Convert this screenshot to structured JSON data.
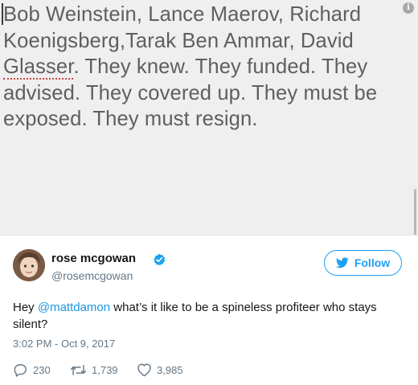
{
  "note": {
    "line1_pre": "Bob Weinstein, Lance Maerov, Richard",
    "line2": "Koenigsberg,Tarak Ben Ammar, David",
    "line3_misspelled": "Glasser",
    "line3_rest": ". They knew. They funded. They",
    "line4": "advised. They covered up. They must be",
    "line5": "exposed. They must resign.",
    "info_glyph": "i"
  },
  "tweet": {
    "display_name": "rose mcgowan",
    "handle": "@rosemcgowan",
    "follow_label": "Follow",
    "text_pre": "Hey ",
    "mention": "@mattdamon",
    "text_post": " what’s it like to be a spineless profiteer who stays silent?",
    "timestamp": "3:02 PM - Oct 9, 2017",
    "replies": "230",
    "retweets": "1,739",
    "likes": "3,985"
  },
  "colors": {
    "accent": "#1da1f2",
    "note_bg": "#efefef",
    "note_text": "#5f5f5f",
    "muted": "#657786"
  },
  "icons": [
    "info-icon",
    "verified-icon",
    "twitter-bird-icon",
    "reply-icon",
    "retweet-icon",
    "heart-icon"
  ]
}
